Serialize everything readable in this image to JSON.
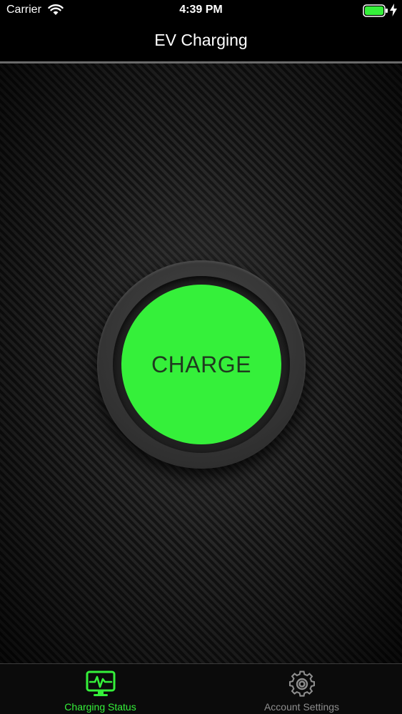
{
  "status_bar": {
    "carrier": "Carrier",
    "time": "4:39 PM",
    "icons": [
      "wifi-icon",
      "battery-icon",
      "charging-bolt-icon"
    ]
  },
  "nav": {
    "title": "EV Charging"
  },
  "main": {
    "charge_button_label": "CHARGE",
    "charge_button_color": "#35f03a"
  },
  "tabs": [
    {
      "label": "Charging Status",
      "icon": "monitor-pulse-icon",
      "active": true
    },
    {
      "label": "Account Settings",
      "icon": "gear-icon",
      "active": false
    }
  ],
  "colors": {
    "accent": "#35f03a",
    "inactive_tab": "#8e8e8e",
    "background": "#000000"
  }
}
